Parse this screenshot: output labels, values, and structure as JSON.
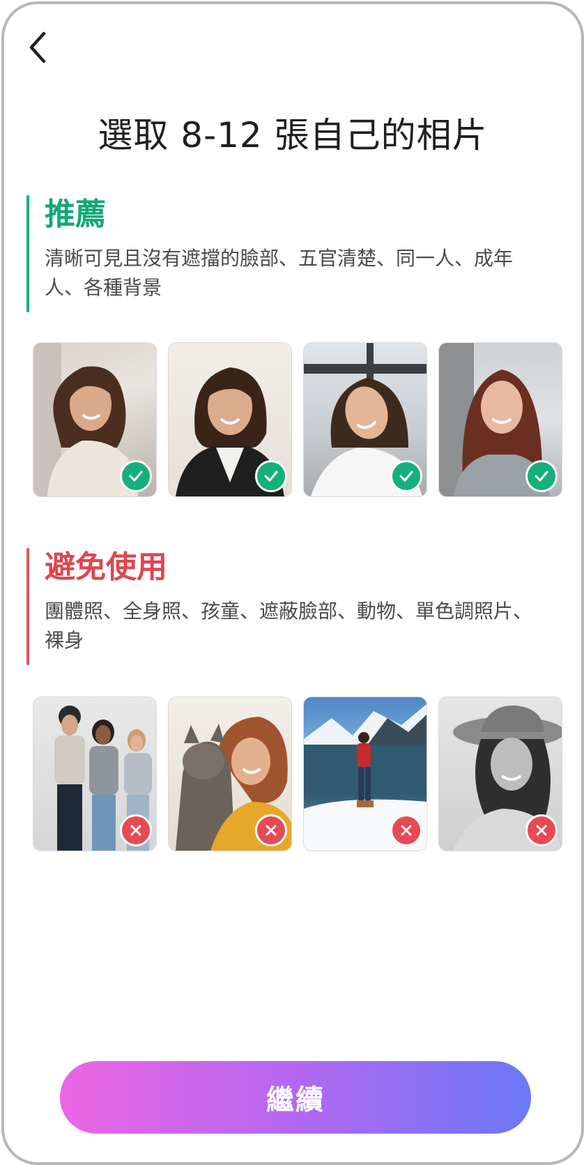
{
  "header": {
    "back_icon": "chevron-left-icon",
    "title": "選取 8-12 張自己的相片"
  },
  "recommended": {
    "heading": "推薦",
    "description": "清晰可見且沒有遮擋的臉部、五官清楚、同一人、成年人、各種背景",
    "accent_color": "#11a876",
    "badge_icon": "check-icon",
    "photos": [
      {
        "subject": "woman-smiling-indoor"
      },
      {
        "subject": "woman-smiling-black-jacket"
      },
      {
        "subject": "woman-tilted-head-white-shirt"
      },
      {
        "subject": "woman-long-hair-gray-sweater"
      }
    ]
  },
  "avoid": {
    "heading": "避免使用",
    "description": "團體照、全身照、孩童、遮蔽臉部、動物、單色調照片、裸身",
    "accent_color": "#e0454f",
    "badge_icon": "close-icon",
    "photos": [
      {
        "subject": "group-photo"
      },
      {
        "subject": "woman-hugging-cat"
      },
      {
        "subject": "full-body-snow-lake"
      },
      {
        "subject": "monochrome-woman-sunhat"
      }
    ]
  },
  "footer": {
    "continue_label": "繼續",
    "gradient": [
      "#ec66e2",
      "#b367f0",
      "#6a78f5"
    ]
  }
}
